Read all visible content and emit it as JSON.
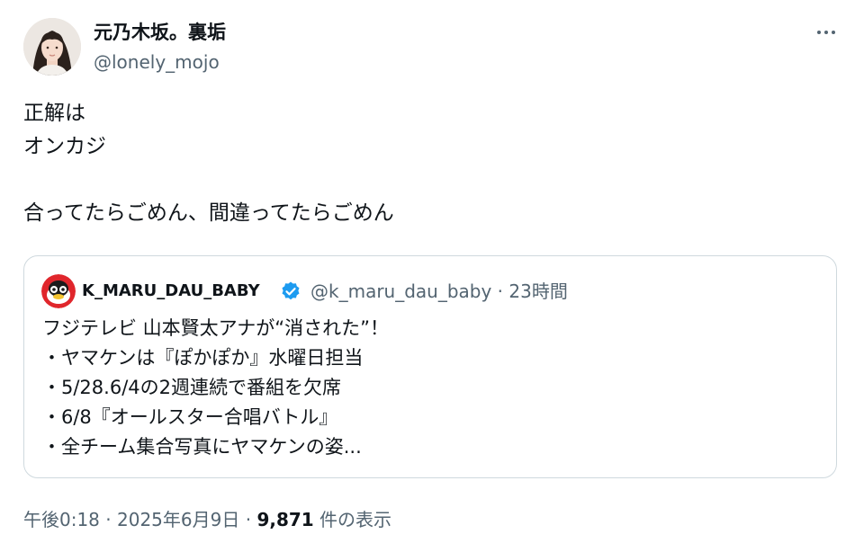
{
  "author": {
    "display_name": "元乃木坂。裏垢",
    "handle": "@lonely_mojo",
    "avatar": "woman-portrait"
  },
  "more_icon": "more-horizontal-icon",
  "tweet": {
    "lines": [
      "正解は",
      "オンカジ",
      "",
      "合ってたらごめん、間違ってたらごめん"
    ]
  },
  "quoted": {
    "display_name": "K_MARU_DAU_BABY",
    "verified_icon": "verified-badge-icon",
    "verified_color": "#1d9bf0",
    "handle": "@k_maru_dau_baby",
    "separator": " · ",
    "time": "23時間",
    "lines": [
      "フジテレビ 山本賢太アナが“消された”！",
      "・ヤマケンは『ぽかぽか』水曜日担当",
      "・5/28.6/4の2週連続で番組を欠席",
      "・6/8『オールスター合唱バトル』",
      "・全チーム集合写真にヤマケンの姿..."
    ]
  },
  "footer": {
    "time": "午後0:18",
    "separator": " · ",
    "date": "2025年6月9日",
    "views_count": "9,871",
    "views_label": " 件の表示"
  },
  "colors": {
    "text": "#0f1419",
    "secondary": "#536471",
    "border": "#cfd9de"
  }
}
